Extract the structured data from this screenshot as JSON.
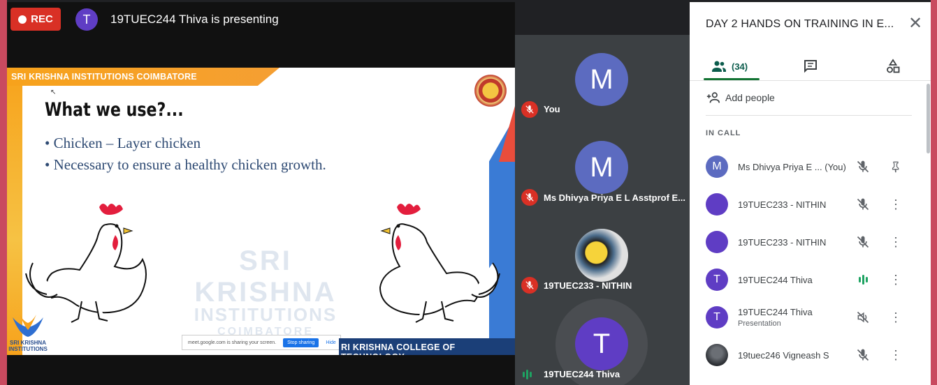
{
  "recording": {
    "label": "REC"
  },
  "presenter": {
    "initial": "T",
    "text": "19TUEC244 Thiva is presenting"
  },
  "slide": {
    "band_text": "SRI KRISHNA INSTITUTIONS COIMBATORE",
    "title": "What we use?...",
    "bullets": [
      "• Chicken – Layer chicken",
      "• Necessary to ensure a healthy chicken growth."
    ],
    "watermark": [
      "SRI KRISHNA",
      "INSTITUTIONS",
      "COIMBATORE"
    ],
    "brand_text": "SRI KRISHNA INSTITUTIONS",
    "footer": "RI KRISHNA COLLEGE OF TECHNOLOGY",
    "share_bar": {
      "message": "meet.google.com is sharing your screen.",
      "stop": "Stop sharing",
      "hide": "Hide"
    }
  },
  "tiles": [
    {
      "initial": "M",
      "name": "You",
      "muted": true
    },
    {
      "initial": "M",
      "name": "Ms Dhivya Priya E L Asstprof E...",
      "muted": true
    },
    {
      "initial": "",
      "name": "19TUEC233 - NITHIN",
      "muted": true
    },
    {
      "initial": "T",
      "name": "19TUEC244 Thiva",
      "muted": false,
      "speaking": true
    }
  ],
  "panel": {
    "title": "DAY 2 HANDS ON TRAINING IN E...",
    "people_count": "(34)",
    "add_people": "Add people",
    "in_call": "IN CALL",
    "people": [
      {
        "initial": "M",
        "name": "Ms Dhivya Priya E ...  (You)",
        "sub": "",
        "state": "muted",
        "action": "pin"
      },
      {
        "initial": "",
        "name": "19TUEC233 - NITHIN",
        "sub": "",
        "state": "muted",
        "action": "more"
      },
      {
        "initial": "",
        "name": "19TUEC233 - NITHIN",
        "sub": "",
        "state": "muted",
        "action": "more"
      },
      {
        "initial": "T",
        "name": "19TUEC244 Thiva",
        "sub": "",
        "state": "speaking",
        "action": "more"
      },
      {
        "initial": "T",
        "name": "19TUEC244 Thiva",
        "sub": "Presentation",
        "state": "audio-off",
        "action": "more"
      },
      {
        "initial": "",
        "name": "19tuec246 Vigneash S",
        "sub": "",
        "state": "muted",
        "action": "more"
      }
    ]
  },
  "colors": {
    "rec": "#d93025",
    "accent_green": "#137333",
    "avatar_purple": "#5f3dc4",
    "avatar_blue": "#5c6bc0"
  }
}
